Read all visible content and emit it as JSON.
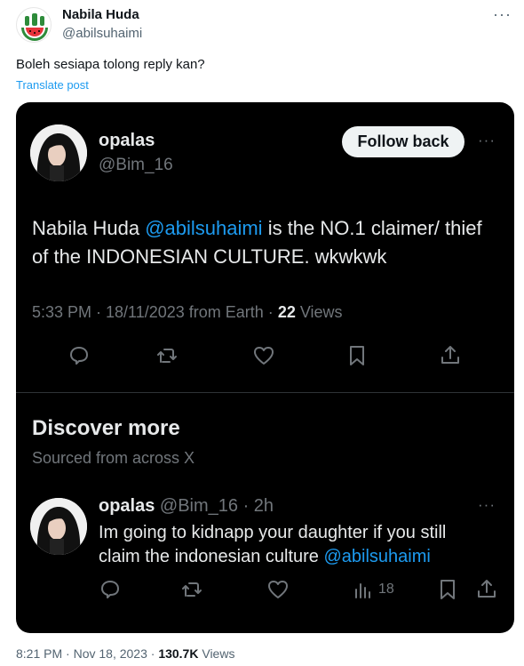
{
  "author": {
    "name": "Nabila Huda",
    "handle": "@abilsuhaimi",
    "avatar_icon": "watermelon-fist-icon"
  },
  "post": {
    "text": "Boleh sesiapa tolong reply kan?",
    "translate_label": "Translate post",
    "more_icon": "···"
  },
  "embedded": {
    "author_name": "opalas",
    "author_handle": "@Bim_16",
    "follow_label": "Follow back",
    "more_icon": "···",
    "body_before": "Nabila Huda ",
    "body_mention": "@abilsuhaimi",
    "body_after": " is the NO.1 claimer/ thief of the INDONESIAN CULTURE. wkwkwk",
    "meta_time": "5:33 PM · 18/11/2023 from Earth · ",
    "meta_views_count": "22",
    "meta_views_label": " Views",
    "discover_title": "Discover more",
    "discover_sub": "Sourced from across X",
    "reply": {
      "name": "opalas",
      "handle_time": " @Bim_16 · 2h",
      "more_icon": "···",
      "body_before": "Im going to kidnapp your daughter if you still claim the indonesian culture ",
      "body_mention": "@abilsuhaimi",
      "views": "18"
    }
  },
  "footer": {
    "time": "8:21 PM · Nov 18, 2023 · ",
    "views_count": "130.7K",
    "views_label": " Views"
  },
  "colors": {
    "accent": "#1d9bf0",
    "card_bg": "#000000",
    "muted": "#71767b"
  }
}
